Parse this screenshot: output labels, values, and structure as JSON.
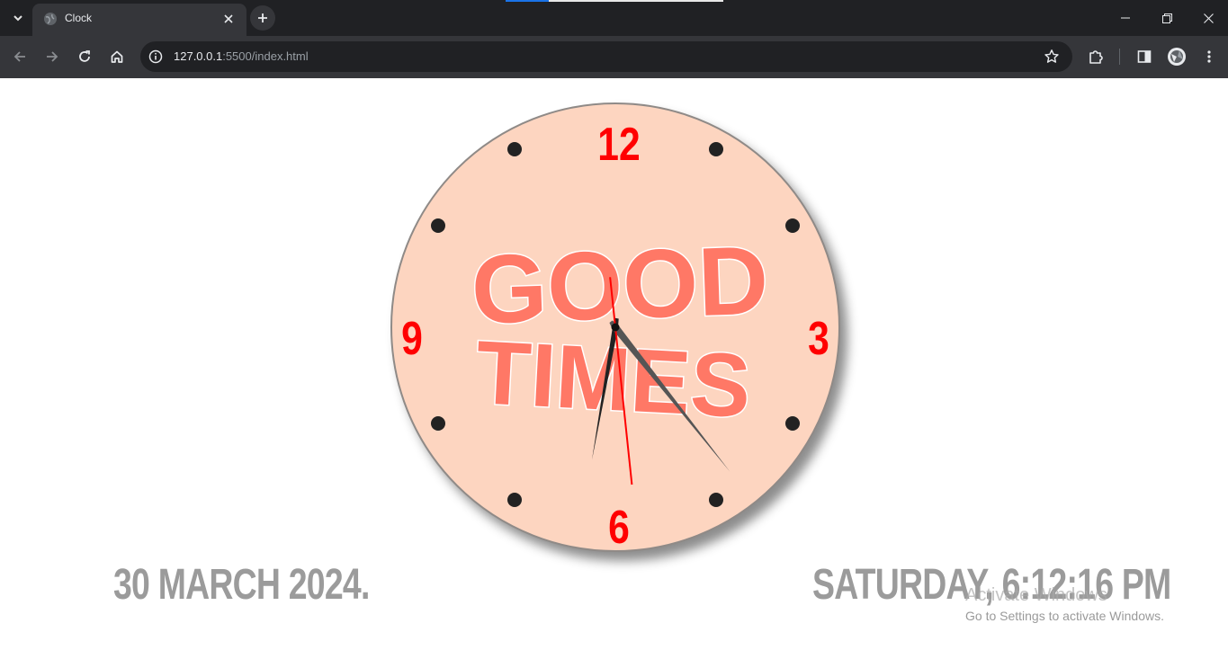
{
  "browser": {
    "tab": {
      "title": "Clock"
    },
    "address_bar": {
      "host": "127.0.0.1",
      "rest": ":5500/index.html"
    }
  },
  "clock": {
    "numbers": {
      "twelve": "12",
      "three": "3",
      "six": "6",
      "nine": "9"
    },
    "face_text": {
      "line1": "GOOD",
      "line2": "TIMES"
    },
    "time": {
      "hours": 6,
      "minutes": 12,
      "seconds": 16
    },
    "colors": {
      "face": "#fdd5c0",
      "numbers": "#ff0000",
      "second_hand": "#ff0000",
      "minute_hand": "#555555",
      "hour_hand": "#222222",
      "text": "#ff7866"
    }
  },
  "footer": {
    "date": "30 MARCH 2024.",
    "day_time": "SATURDAY, 6:12:16 PM"
  },
  "watermark": {
    "title": "Activate Windows",
    "subtitle": "Go to Settings to activate Windows."
  }
}
